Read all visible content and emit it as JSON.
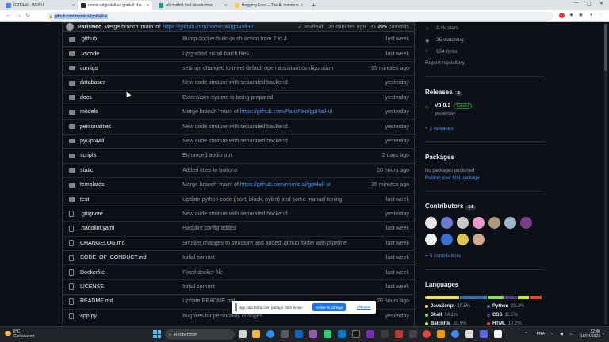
{
  "browser": {
    "tabs": [
      {
        "title": "GPT4All - WEBUI",
        "color": "#3b82f6",
        "active": false
      },
      {
        "title": "nomic-ai/gpt4all-ui: gpt4all cha",
        "color": "#24292f",
        "active": true
      },
      {
        "title": "AI chatbot tool introduction",
        "color": "#10a37f",
        "active": false
      },
      {
        "title": "Hugging Face – The AI commun",
        "color": "#ffcc4d",
        "active": false
      }
    ],
    "new_tab": "+",
    "url": "github.com/nomic-ai/gpt4all-ui",
    "back": "←",
    "forward": "→",
    "reload": "C"
  },
  "commit": {
    "author": "ParisNeo",
    "message": "Merge branch 'main' of",
    "link": "https://github.com/nomic-ai/gpt4all-ui",
    "check": "✓",
    "sha": "a5dfe4f",
    "time": "35 minutes ago",
    "commits_count": "225",
    "commits_label": "commits"
  },
  "files": [
    {
      "name": ".github",
      "type": "folder",
      "message": "Bump docker/build-push-action from 2 to 4",
      "link": "",
      "time": "last week"
    },
    {
      "name": ".vscode",
      "type": "folder",
      "message": "Upgraded install batch files",
      "link": "",
      "time": "last week"
    },
    {
      "name": "configs",
      "type": "folder",
      "message": "settings changed to meet default open assistant configuration",
      "link": "",
      "time": "35 minutes ago"
    },
    {
      "name": "databases",
      "type": "folder",
      "message": "New code struture with separated backend",
      "link": "",
      "time": "yesterday"
    },
    {
      "name": "docs",
      "type": "folder",
      "message": "Extensions system is being prepared",
      "link": "",
      "time": "yesterday"
    },
    {
      "name": "models",
      "type": "folder",
      "message": "Merge branch 'main' of ",
      "link": "https://github.com/ParisNeo/gpt4all-ui",
      "time": "yesterday"
    },
    {
      "name": "personalities",
      "type": "folder",
      "message": "New code struture with separated backend",
      "link": "",
      "time": "yesterday"
    },
    {
      "name": "pyGpt4All",
      "type": "folder",
      "message": "New code struture with separated backend",
      "link": "",
      "time": "yesterday"
    },
    {
      "name": "scripts",
      "type": "folder",
      "message": "Enhanced audio out",
      "link": "",
      "time": "2 days ago"
    },
    {
      "name": "static",
      "type": "folder",
      "message": "Added titles to buttons",
      "link": "",
      "time": "20 hours ago"
    },
    {
      "name": "templates",
      "type": "folder",
      "message": "Merge branch 'main' of ",
      "link": "https://github.com/nomic-ai/gpt4all-ui",
      "time": "35 minutes ago"
    },
    {
      "name": "test",
      "type": "folder",
      "message": "Update python code (isort, black, pylint) and some manual tuning",
      "link": "",
      "time": "last week"
    },
    {
      "name": ".gitignore",
      "type": "file",
      "message": "New code struture with separated backend",
      "link": "",
      "time": "yesterday"
    },
    {
      "name": ".hadolint.yaml",
      "type": "file",
      "message": "Hadolint config added",
      "link": "",
      "time": "last week"
    },
    {
      "name": "CHANGELOG.md",
      "type": "file",
      "message": "Smaller changes to structure and added .github folder with pipeline",
      "link": "",
      "time": "last week"
    },
    {
      "name": "CODE_OF_CONDUCT.md",
      "type": "file",
      "message": "Initial commit",
      "link": "",
      "time": "last week"
    },
    {
      "name": "Dockerfile",
      "type": "file",
      "message": "Fixed docker file",
      "link": "",
      "time": "last week"
    },
    {
      "name": "LICENSE",
      "type": "file",
      "message": "Initial commit",
      "link": "",
      "time": "last week"
    },
    {
      "name": "README.md",
      "type": "file",
      "message": "Update README.md",
      "link": "",
      "time": "20 hours ago"
    },
    {
      "name": "app.py",
      "type": "file",
      "message": "Bugfixes for personality changes",
      "link": "",
      "time": "yesterday"
    }
  ],
  "sidebar": {
    "stars": "1.4k stars",
    "watching": "25 watching",
    "forks": "154 forks",
    "report": "Report repository",
    "releases_title": "Releases",
    "releases_count": "3",
    "release_tag": "V0.0.3",
    "release_latest": "Latest",
    "release_time": "yesterday",
    "more_releases": "+ 2 releases",
    "packages_title": "Packages",
    "packages_none": "No packages published",
    "packages_link": "Publish your first package",
    "contributors_title": "Contributors",
    "contributors_count": "14",
    "contributors_colors": [
      "#e8e8e8",
      "#6a7bd0",
      "#c9c9c9",
      "#e89ac8",
      "#a89878",
      "#9ab8c8",
      "#7a3f8a",
      "#f0f0f0",
      "#3a6fd0",
      "#e0c050",
      "#d0a890"
    ],
    "more_contributors": "+ 3 contributors",
    "languages_title": "Languages",
    "languages": [
      {
        "name": "JavaScript",
        "pct": "30.5%",
        "color": "#f1e05a"
      },
      {
        "name": "Python",
        "pct": "23.3%",
        "color": "#3572A5"
      },
      {
        "name": "Shell",
        "pct": "14.1%",
        "color": "#89e051"
      },
      {
        "name": "CSS",
        "pct": "11.0%",
        "color": "#563d7c"
      },
      {
        "name": "Batchfile",
        "pct": "10.5%",
        "color": "#C1F12E"
      },
      {
        "name": "HTML",
        "pct": "10.2%",
        "color": "#e34c26"
      }
    ]
  },
  "share_bar": {
    "message": "app.clipchamp.com partage votre écran.",
    "button": "Arrêter le partage",
    "hide": "Masquer"
  },
  "taskbar": {
    "temp": "8°C",
    "weather": "Ciel couvert",
    "search": "Rechercher",
    "lang": "FRA",
    "time": "12:40",
    "date": "18/04/2023"
  }
}
